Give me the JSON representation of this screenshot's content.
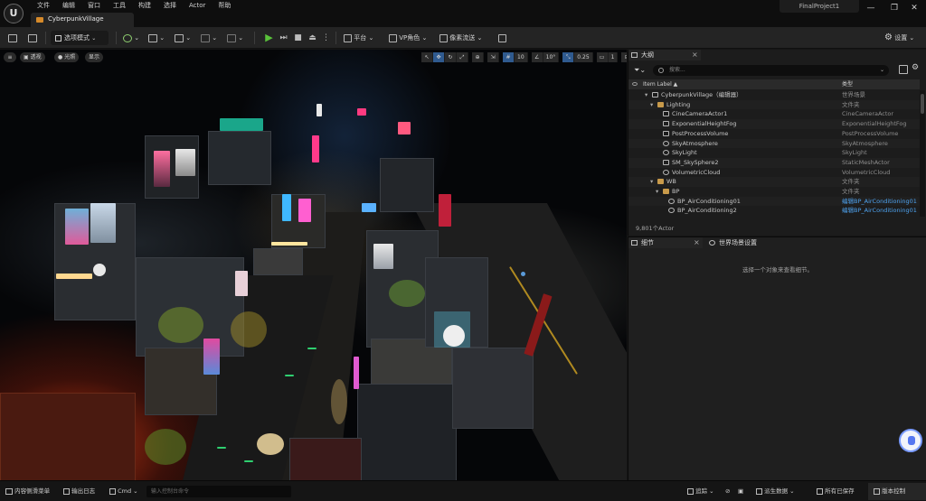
{
  "menu": [
    "文件",
    "编辑",
    "窗口",
    "工具",
    "构建",
    "选择",
    "Actor",
    "帮助"
  ],
  "document_tab": "CyberpunkVillage",
  "project_name": "FinalProject1",
  "window_controls": {
    "minimize": "—",
    "maximize": "❐",
    "close": "✕"
  },
  "toolbar": {
    "mode": "选项模式",
    "platform": "平台",
    "vp_role": "VP角色",
    "pixel_streaming": "像素流送",
    "settings": "设置"
  },
  "viewport": {
    "perspective": "透视",
    "lit": "光照",
    "show": "显示",
    "grid_snap": "10",
    "rotation_snap": "10°",
    "scale_snap": "0.25",
    "camera_speed": "1"
  },
  "outliner": {
    "tab": "大纲",
    "search_placeholder": "搜索...",
    "col_label": "Item Label ▲",
    "col_type": "类型",
    "rows": [
      {
        "label": "CyberpunkVillage（编辑器）",
        "type": "世界场景",
        "link": false
      },
      {
        "label": "Lighting",
        "type": "文件夹",
        "link": false
      },
      {
        "label": "CineCameraActor1",
        "type": "CineCameraActor",
        "link": false
      },
      {
        "label": "ExponentialHeightFog",
        "type": "ExponentialHeightFog",
        "link": false
      },
      {
        "label": "PostProcessVolume",
        "type": "PostProcessVolume",
        "link": false
      },
      {
        "label": "SkyAtmosphere",
        "type": "SkyAtmosphere",
        "link": false
      },
      {
        "label": "SkyLight",
        "type": "SkyLight",
        "link": false
      },
      {
        "label": "SM_SkySphere2",
        "type": "StaticMeshActor",
        "link": false
      },
      {
        "label": "VolumetricCloud",
        "type": "VolumetricCloud",
        "link": false
      },
      {
        "label": "WB",
        "type": "文件夹",
        "link": false
      },
      {
        "label": "BP",
        "type": "文件夹",
        "link": false
      },
      {
        "label": "BP_AirConditioning01",
        "type": "编辑BP_AirConditioning01",
        "link": true
      },
      {
        "label": "BP_AirConditioning2",
        "type": "编辑BP_AirConditioning01",
        "link": true
      }
    ],
    "actor_count": "9,801个Actor"
  },
  "details": {
    "tab": "细节",
    "world_settings_tab": "世界场景设置",
    "empty_text": "选择一个对象来查看细节。"
  },
  "statusbar": {
    "content_drawer": "内容侧滑菜单",
    "output_log": "输出日志",
    "cmd": "Cmd",
    "cmd_placeholder": "输入控制台命令",
    "trace": "追踪",
    "derived_data": "派生数据",
    "saved": "所有已保存",
    "version_control": "版本控制"
  }
}
